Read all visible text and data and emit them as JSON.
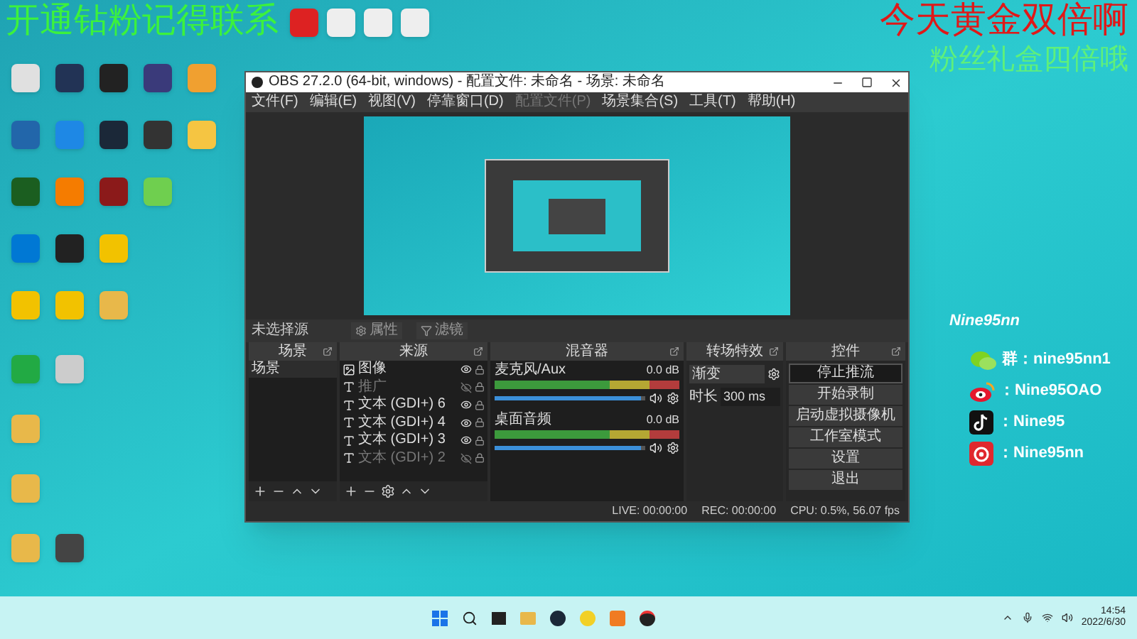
{
  "banner": {
    "left": "开通钻粉记得联系",
    "right_top": "今天黄金双倍啊",
    "right_bottom": "粉丝礼盒四倍哦"
  },
  "social": {
    "title": "Nine95nn",
    "items": [
      {
        "kind": "chat",
        "text": "群：nine95nn1"
      },
      {
        "kind": "weibo",
        "text": "：Nine95OAO"
      },
      {
        "kind": "note",
        "text": "：Nine95"
      },
      {
        "kind": "spiral",
        "text": "：Nine95nn"
      }
    ]
  },
  "obs": {
    "title": "OBS 27.2.0 (64-bit, windows) - 配置文件: 未命名 - 场景: 未命名",
    "menu": [
      {
        "label": "文件(F)",
        "disabled": false
      },
      {
        "label": "编辑(E)",
        "disabled": false
      },
      {
        "label": "视图(V)",
        "disabled": false
      },
      {
        "label": "停靠窗口(D)",
        "disabled": false
      },
      {
        "label": "配置文件(P)",
        "disabled": true
      },
      {
        "label": "场景集合(S)",
        "disabled": false
      },
      {
        "label": "工具(T)",
        "disabled": false
      },
      {
        "label": "帮助(H)",
        "disabled": false
      }
    ],
    "toolbar": {
      "status": "未选择源",
      "properties": "属性",
      "filters": "滤镜"
    },
    "scenes": {
      "title": "场景",
      "items": [
        {
          "label": "场景",
          "selected": true
        }
      ]
    },
    "sources": {
      "title": "来源",
      "items": [
        {
          "kind": "image",
          "label": "图像",
          "visible": true
        },
        {
          "kind": "text",
          "label": "推广",
          "visible": false
        },
        {
          "kind": "text",
          "label": "文本 (GDI+) 6",
          "visible": true
        },
        {
          "kind": "text",
          "label": "文本 (GDI+) 4",
          "visible": true
        },
        {
          "kind": "text",
          "label": "文本 (GDI+) 3",
          "visible": true
        },
        {
          "kind": "text",
          "label": "文本 (GDI+) 2",
          "visible": false
        }
      ]
    },
    "mixer": {
      "title": "混音器",
      "channels": [
        {
          "name": "麦克风/Aux",
          "reading": "0.0 dB",
          "level": 0.97
        },
        {
          "name": "桌面音频",
          "reading": "0.0 dB",
          "level": 0.97
        }
      ]
    },
    "transitions": {
      "title": "转场特效",
      "value": "渐变",
      "duration_label": "时长",
      "duration": "300 ms"
    },
    "controls": {
      "title": "控件",
      "buttons": [
        {
          "label": "停止推流",
          "active": true
        },
        {
          "label": "开始录制",
          "active": false
        },
        {
          "label": "启动虚拟摄像机",
          "active": false
        },
        {
          "label": "工作室模式",
          "active": false
        },
        {
          "label": "设置",
          "active": false
        },
        {
          "label": "退出",
          "active": false
        }
      ]
    },
    "status": {
      "live": "LIVE: 00:00:00",
      "rec": "REC: 00:00:00",
      "cpu": "CPU: 0.5%, 56.07 fps"
    }
  },
  "clock": {
    "time": "14:54",
    "date": "2022/6/30"
  }
}
